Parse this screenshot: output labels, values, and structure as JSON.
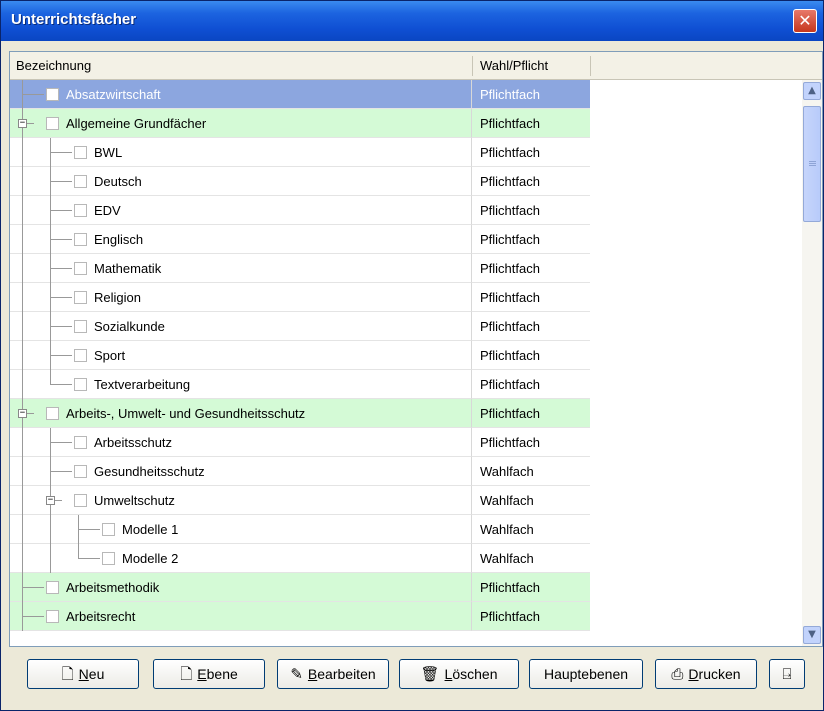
{
  "window": {
    "title": "Unterrichtsfächer",
    "close_glyph": "✕"
  },
  "columns": {
    "col1": "Bezeichnung",
    "col2": "Wahl/Pflicht"
  },
  "rows": [
    {
      "label": "Absatzwirtschaft",
      "type": "Pflichtfach",
      "level": 0,
      "style": "sel"
    },
    {
      "label": "Allgemeine Grundfächer",
      "type": "Pflichtfach",
      "level": 0,
      "style": "green",
      "expander": "−"
    },
    {
      "label": "BWL",
      "type": "Pflichtfach",
      "level": 1
    },
    {
      "label": "Deutsch",
      "type": "Pflichtfach",
      "level": 1
    },
    {
      "label": "EDV",
      "type": "Pflichtfach",
      "level": 1
    },
    {
      "label": "Englisch",
      "type": "Pflichtfach",
      "level": 1
    },
    {
      "label": "Mathematik",
      "type": "Pflichtfach",
      "level": 1
    },
    {
      "label": "Religion",
      "type": "Pflichtfach",
      "level": 1
    },
    {
      "label": "Sozialkunde",
      "type": "Pflichtfach",
      "level": 1
    },
    {
      "label": "Sport",
      "type": "Pflichtfach",
      "level": 1
    },
    {
      "label": "Textverarbeitung",
      "type": "Pflichtfach",
      "level": 1
    },
    {
      "label": "Arbeits-, Umwelt- und Gesundheitsschutz",
      "type": "Pflichtfach",
      "level": 0,
      "style": "green",
      "expander": "−"
    },
    {
      "label": "Arbeitsschutz",
      "type": "Pflichtfach",
      "level": 1
    },
    {
      "label": "Gesundheitsschutz",
      "type": "Wahlfach",
      "level": 1
    },
    {
      "label": "Umweltschutz",
      "type": "Wahlfach",
      "level": 1,
      "expander": "−"
    },
    {
      "label": "Modelle 1",
      "type": "Wahlfach",
      "level": 2
    },
    {
      "label": "Modelle 2",
      "type": "Wahlfach",
      "level": 2
    },
    {
      "label": "Arbeitsmethodik",
      "type": "Pflichtfach",
      "level": 0,
      "style": "green"
    },
    {
      "label": "Arbeitsrecht",
      "type": "Pflichtfach",
      "level": 0,
      "style": "green"
    }
  ],
  "scrollbar": {
    "up_glyph": "▲",
    "down_glyph": "▼"
  },
  "buttons": [
    {
      "name": "new-button",
      "icon": "new-document-icon",
      "glyph": "🗋",
      "pre": "",
      "u": "N",
      "post": "eu"
    },
    {
      "name": "level-button",
      "icon": "new-level-icon",
      "glyph": "🗋",
      "pre": "",
      "u": "E",
      "post": "bene"
    },
    {
      "name": "edit-button",
      "icon": "edit-icon",
      "glyph": "✎",
      "pre": "",
      "u": "B",
      "post": "earbeiten"
    },
    {
      "name": "delete-button",
      "icon": "trash-icon",
      "glyph": "🗑",
      "pre": "",
      "u": "L",
      "post": "öschen"
    },
    {
      "name": "main-levels-button",
      "icon": "",
      "glyph": "",
      "pre": "Hauptebenen",
      "u": "",
      "post": ""
    },
    {
      "name": "print-button",
      "icon": "printer-icon",
      "glyph": "⎙",
      "pre": "",
      "u": "D",
      "post": "rucken"
    },
    {
      "name": "exit-button",
      "icon": "exit-door-icon",
      "glyph": "⍈",
      "pre": "",
      "u": "",
      "post": ""
    }
  ]
}
